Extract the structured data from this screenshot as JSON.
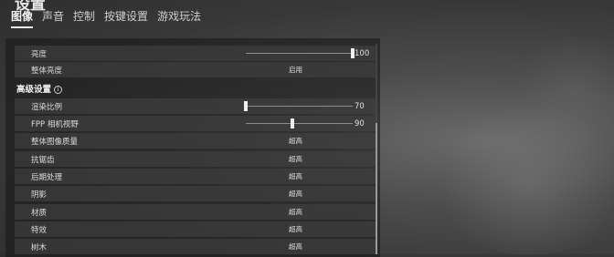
{
  "header": {
    "title": "设置"
  },
  "tabs": [
    {
      "label": "图像",
      "active": true
    },
    {
      "label": "声音",
      "active": false
    },
    {
      "label": "控制",
      "active": false
    },
    {
      "label": "按键设置",
      "active": false
    },
    {
      "label": "游戏玩法",
      "active": false
    }
  ],
  "rows": {
    "brightness": {
      "label": "亮度",
      "value": "100",
      "level": 1.0
    },
    "overall_brightness": {
      "label": "整体亮度",
      "value": "启用"
    },
    "advanced": {
      "label": "高级设置",
      "icon": "info-icon"
    },
    "render_scale": {
      "label": "渲染比例",
      "value": "70",
      "level": 0.0
    },
    "fpp_fov": {
      "label": "FPP 相机视野",
      "value": "90",
      "level": 0.44
    },
    "overall_quality": {
      "label": "整体图像质量",
      "value": "超高"
    },
    "anti_aliasing": {
      "label": "抗锯齿",
      "value": "超高"
    },
    "post_processing": {
      "label": "后期处理",
      "value": "超高"
    },
    "shadows": {
      "label": "阴影",
      "value": "超高"
    },
    "textures": {
      "label": "材质",
      "value": "超高"
    },
    "effects": {
      "label": "特效",
      "value": "超高"
    },
    "foliage": {
      "label": "树木",
      "value": "超高"
    }
  }
}
